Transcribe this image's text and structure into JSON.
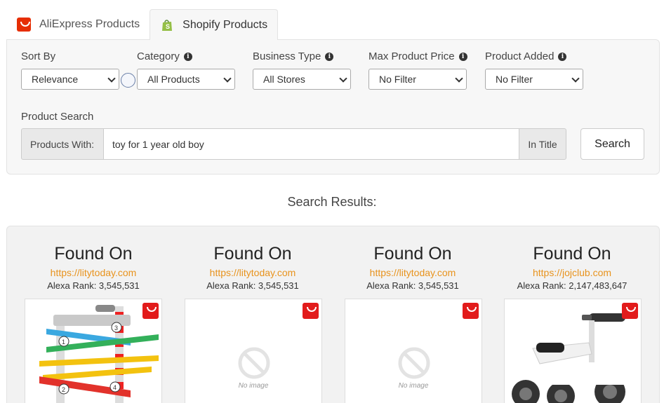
{
  "tabs": [
    {
      "label": "AliExpress Products",
      "icon": "aliexpress-icon",
      "active": false
    },
    {
      "label": "Shopify Products",
      "icon": "shopify-bag-icon",
      "active": true
    }
  ],
  "filters": {
    "sort_by": {
      "label": "Sort By",
      "value": "Relevance"
    },
    "category": {
      "label": "Category",
      "value": "All Products"
    },
    "business_type": {
      "label": "Business Type",
      "value": "All Stores"
    },
    "max_price": {
      "label": "Max Product Price",
      "value": "No Filter"
    },
    "product_added": {
      "label": "Product Added",
      "value": "No Filter"
    }
  },
  "search": {
    "section_label": "Product Search",
    "prefix": "Products With:",
    "query": "toy for 1 year old boy",
    "suffix": "In Title",
    "button": "Search"
  },
  "results_title": "Search Results:",
  "results": [
    {
      "found_label": "Found On",
      "url": "https://litytoday.com",
      "rank": "Alexa Rank: 3,545,531",
      "image": "toy-car-ramp"
    },
    {
      "found_label": "Found On",
      "url": "https://litytoday.com",
      "rank": "Alexa Rank: 3,545,531",
      "image": "no-image",
      "no_image_text": "No image"
    },
    {
      "found_label": "Found On",
      "url": "https://litytoday.com",
      "rank": "Alexa Rank: 3,545,531",
      "image": "no-image",
      "no_image_text": "No image"
    },
    {
      "found_label": "Found On",
      "url": "https://jojclub.com",
      "rank": "Alexa Rank: 2,147,483,647",
      "image": "balance-bike"
    }
  ],
  "colors": {
    "accent_link": "#e8931d",
    "aliexpress_red": "#e21b1b",
    "shopify_green": "#95bf47"
  }
}
